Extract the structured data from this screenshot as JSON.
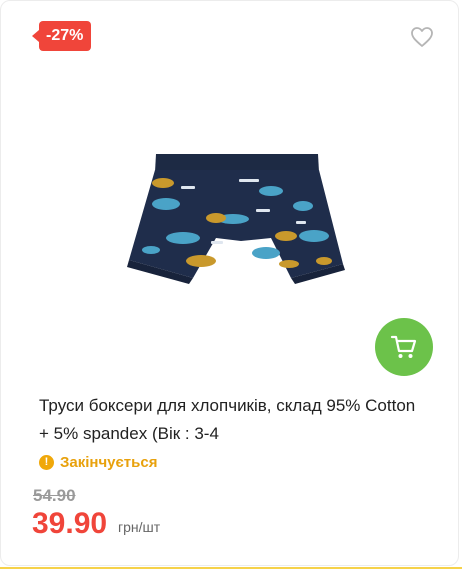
{
  "product": {
    "discount_badge": "-27%",
    "title": "Труси боксери для хлопчиків, склад 95% Cotton+ 5% spandex (Вік : 3-4",
    "status_text": "Закінчується",
    "status_icon_glyph": "!",
    "old_price": "54.90",
    "price": "39.90",
    "unit": "грн/шт"
  },
  "icons": {
    "favorite": "heart-icon",
    "cart": "shopping-cart-icon",
    "status": "warning-icon"
  },
  "colors": {
    "accent_red": "#f0453a",
    "cart_green": "#6cc24a",
    "status_orange": "#e8a10c"
  }
}
